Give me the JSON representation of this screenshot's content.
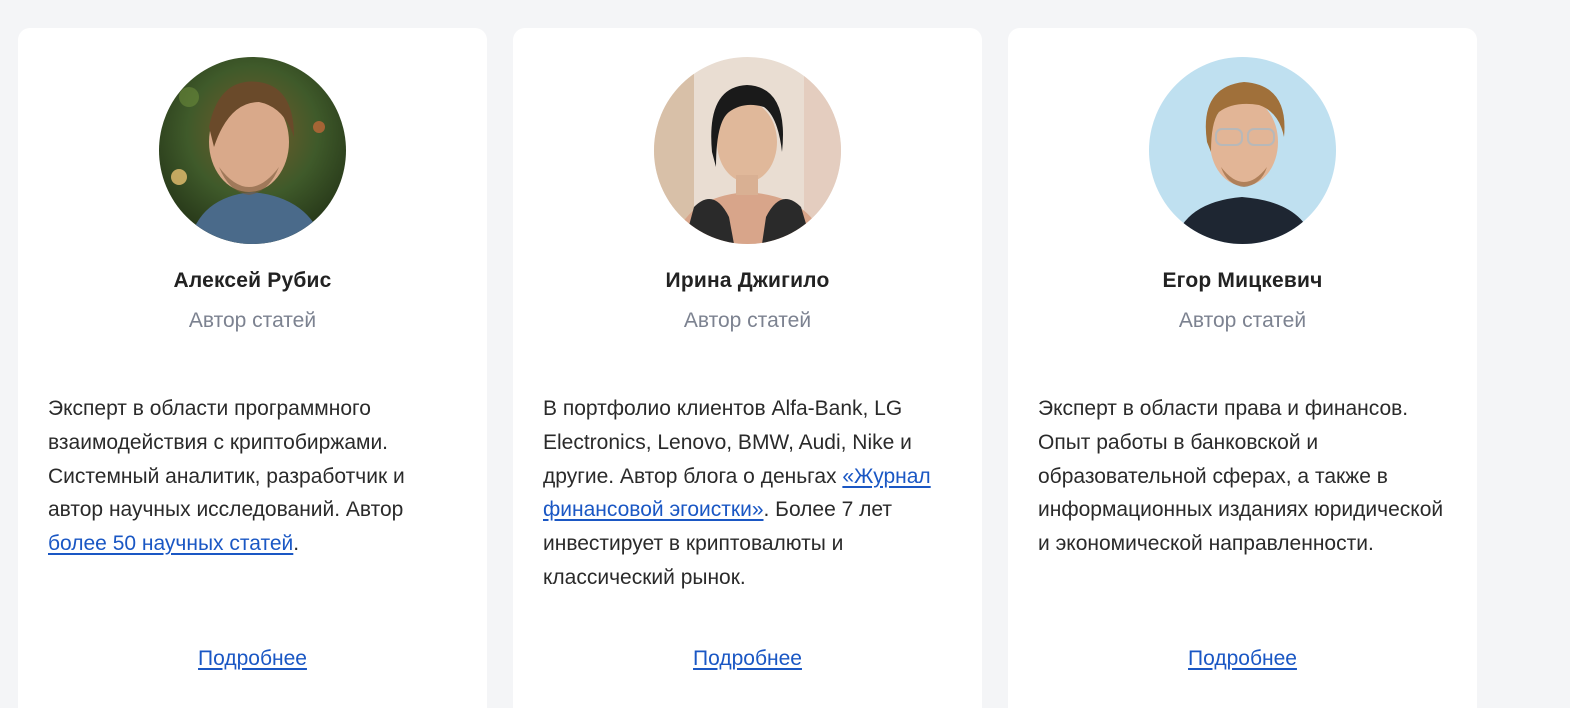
{
  "authors": [
    {
      "name": "Алексей Рубис",
      "role": "Автор статей",
      "bio_before": "Эксперт в области программного взаимодействия с криптобиржами. Системный аналитик, разработчик и автор научных исследований. Автор ",
      "bio_link": "более 50 научных статей",
      "bio_after": ".",
      "more": "Подробнее",
      "avatar_bg": "#3f5a2a"
    },
    {
      "name": "Ирина Джигило",
      "role": "Автор статей",
      "bio_before": "В портфолио клиентов Alfa-Bank, LG Electronics, Lenovo, BMW, Audi, Nike и другие. Автор блога о деньгах ",
      "bio_link": "«Журнал финансовой эгоистки»",
      "bio_after": ". Более 7 лет инвестирует в криптовалюты и классический рынок.",
      "more": "Подробнее",
      "avatar_bg": "#e9ddd2"
    },
    {
      "name": "Егор Мицкевич",
      "role": "Автор статей",
      "bio_before": "Эксперт в области права и финансов. Опыт работы в банковской и образовательной сферах, а также в информационных изданиях юридической и экономической направленности.",
      "bio_link": "",
      "bio_after": "",
      "more": "Подробнее",
      "avatar_bg": "#bfe0f0"
    }
  ],
  "colors": {
    "page_bg": "#f4f5f7",
    "card_bg": "#ffffff",
    "link": "#1a57c4",
    "muted": "#7c8290"
  }
}
